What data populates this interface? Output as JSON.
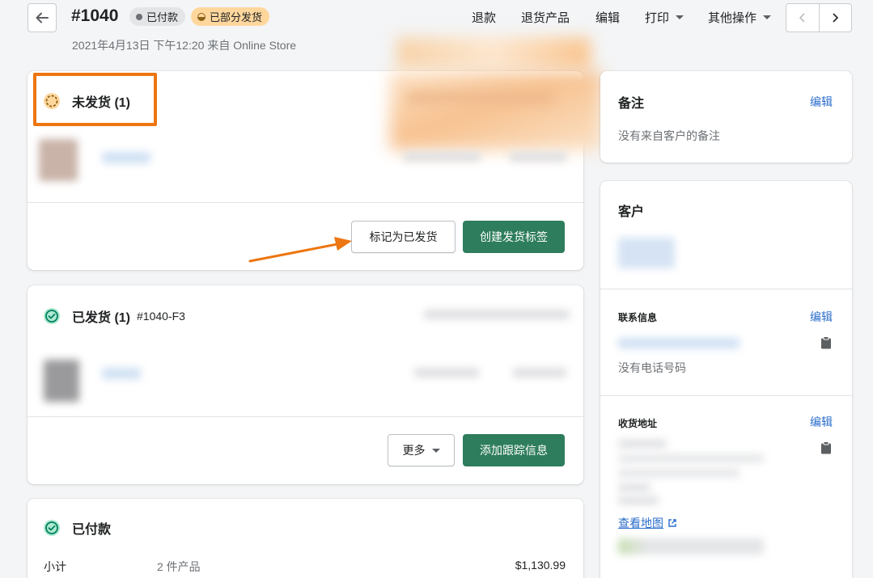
{
  "header": {
    "order_number": "#1040",
    "badge_paid": "已付款",
    "badge_partial": "已部分发货",
    "subtitle": "2021年4月13日 下午12:20 来自 Online Store",
    "actions": {
      "refund": "退款",
      "return": "退货产品",
      "edit": "编辑",
      "print": "打印",
      "more": "其他操作"
    }
  },
  "unfulfilled": {
    "title": "未发货 (1)",
    "mark_fulfilled": "标记为已发货",
    "create_label": "创建发货标签"
  },
  "fulfilled": {
    "title": "已发货 (1)",
    "fulfillment_id": "#1040-F3",
    "more": "更多",
    "add_tracking": "添加跟踪信息"
  },
  "paid": {
    "title": "已付款",
    "subtotal_label": "小计",
    "subtotal_items": "2 件产品",
    "subtotal_amount": "$1,130.99"
  },
  "sidebar": {
    "notes": {
      "title": "备注",
      "edit": "编辑",
      "empty": "没有来自客户的备注"
    },
    "customer": {
      "title": "客户",
      "contact_title": "联系信息",
      "contact_edit": "编辑",
      "no_phone": "没有电话号码",
      "address_title": "收货地址",
      "address_edit": "编辑",
      "view_map": "查看地图"
    }
  },
  "colors": {
    "primary": "#2e7d5c",
    "link": "#2c6ecb",
    "highlight": "#ed7611",
    "badge_partial": "#ffd79d"
  }
}
